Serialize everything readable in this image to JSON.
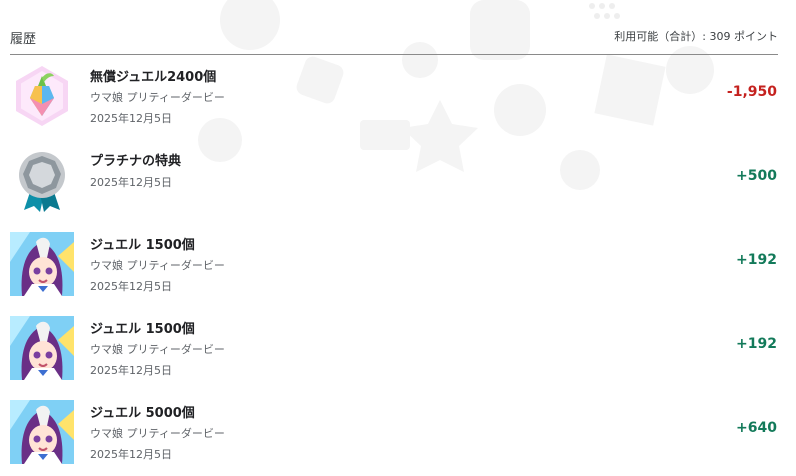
{
  "header": {
    "title": "履歴",
    "available": "利用可能（合計）: 309 ポイント"
  },
  "colors": {
    "negative": "#c5221f",
    "positive": "#137a5a"
  },
  "items": [
    {
      "icon": "jewel-icon",
      "name": "無償ジュエル2400個",
      "subtitle": "ウマ娘 プリティーダービー",
      "date": "2025年12月5日",
      "amount": "-1,950",
      "sign": "negative"
    },
    {
      "icon": "platinum-badge-icon",
      "name": "プラチナの特典",
      "date": "2025年12月5日",
      "amount": "+500",
      "sign": "positive"
    },
    {
      "icon": "character-avatar",
      "name": "ジュエル 1500個",
      "subtitle": "ウマ娘 プリティーダービー",
      "date": "2025年12月5日",
      "amount": "+192",
      "sign": "positive"
    },
    {
      "icon": "character-avatar",
      "name": "ジュエル 1500個",
      "subtitle": "ウマ娘 プリティーダービー",
      "date": "2025年12月5日",
      "amount": "+192",
      "sign": "positive"
    },
    {
      "icon": "character-avatar",
      "name": "ジュエル 5000個",
      "subtitle": "ウマ娘 プリティーダービー",
      "date": "2025年12月5日",
      "amount": "+640",
      "sign": "positive"
    }
  ]
}
